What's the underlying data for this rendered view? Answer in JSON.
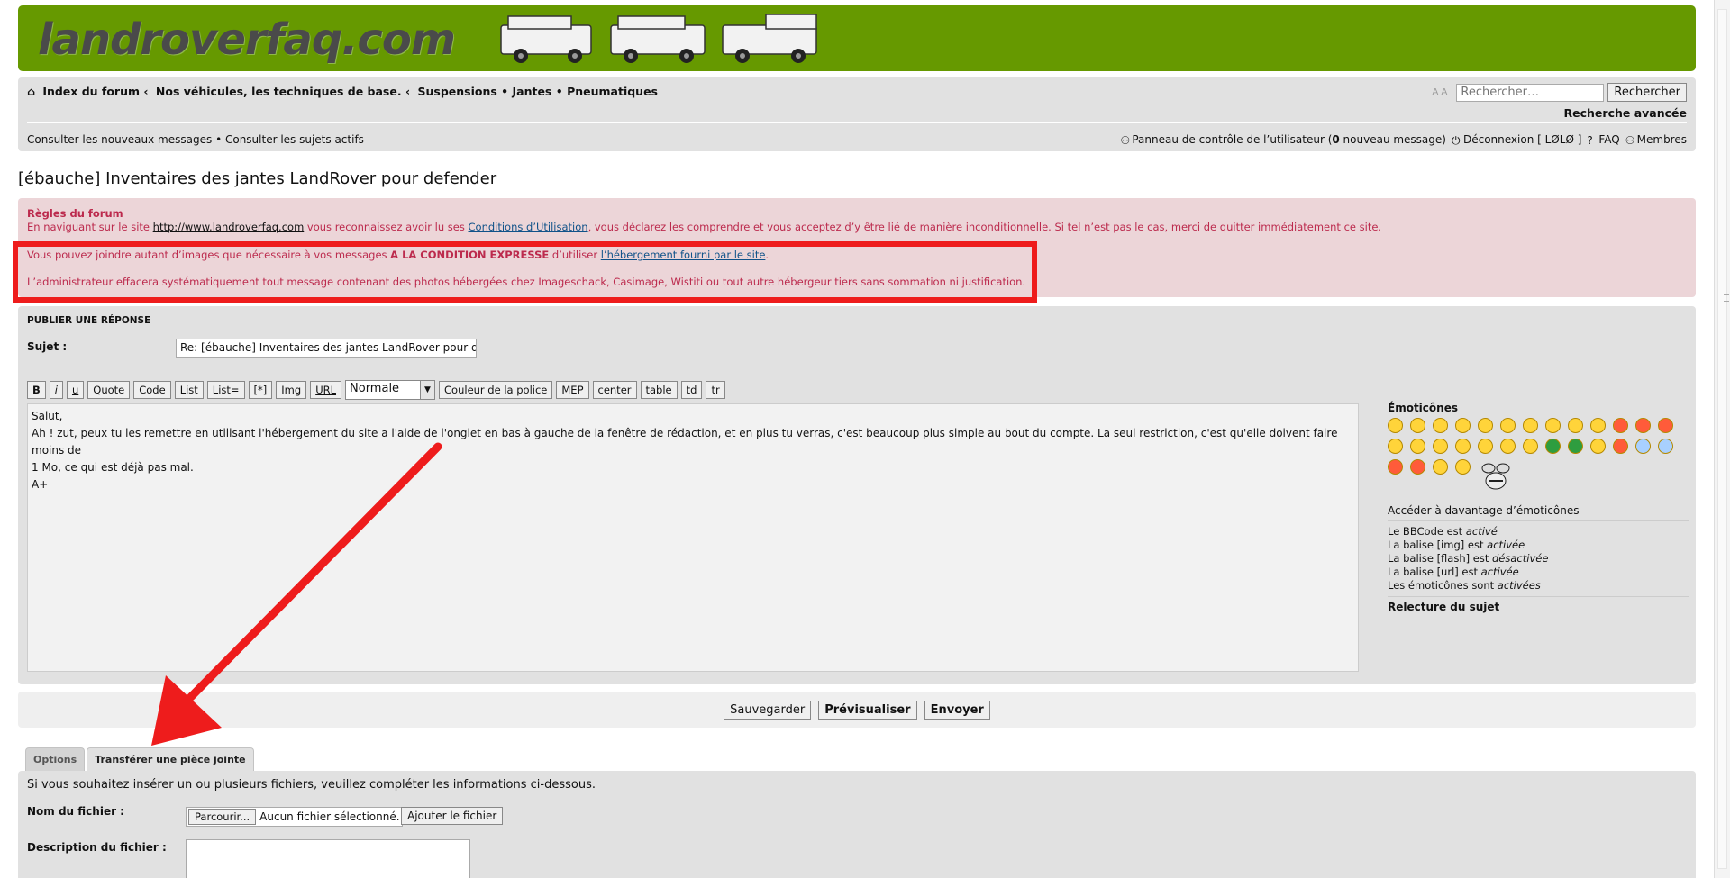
{
  "site": {
    "logo_text": "landroverfaq.com"
  },
  "navbar": {
    "breadcrumb": [
      {
        "label": "Index du forum"
      },
      {
        "label": "Nos véhicules, les techniques de base."
      },
      {
        "label": "Suspensions • Jantes • Pneumatiques"
      }
    ],
    "search_placeholder": "Rechercher…",
    "search_button": "Rechercher",
    "advanced_search": "Recherche avancée",
    "font_controls": "A A",
    "new_messages": "Consulter les nouveaux messages",
    "separator": "•",
    "active_topics": "Consulter les sujets actifs",
    "ucp_pre": "Panneau de contrôle de l’utilisateur (",
    "ucp_count": "0",
    "ucp_post": " nouveau message)",
    "logout": "Déconnexion [ LØLØ ]",
    "faq": "FAQ",
    "members": "Membres"
  },
  "topic": {
    "title": "[ébauche] Inventaires des jantes LandRover pour defender"
  },
  "rules": {
    "title": "Règles du forum",
    "line1_a": "En naviguant sur le site ",
    "line1_site": "http://www.landroverfaq.com",
    "line1_b": " vous reconnaissez avoir lu ses ",
    "line1_link": "Conditions d’Utilisation",
    "line1_c": ", vous déclarez les comprendre et vous acceptez d’y être lié de manière inconditionnelle. Si tel n’est pas le cas, merci de quitter immédiatement ce site.",
    "line2_a": "Vous pouvez joindre autant d’images que nécessaire à vos messages ",
    "line2_bold": "A LA CONDITION EXPRESSE",
    "line2_b": " d’utiliser ",
    "line2_link": "l’hébergement fourni par le site",
    "line2_c": ".",
    "line3": "L’administrateur effacera systématiquement tout message contenant des photos hébergées chez Imageschack, Casimage, Wistiti ou tout autre hébergeur tiers sans sommation ni justification."
  },
  "post": {
    "panel_title": "Publier une réponse",
    "subject_label": "Sujet :",
    "subject_value": "Re: [ébauche] Inventaires des jantes LandRover pour de",
    "toolbar": [
      "B",
      "i",
      "u",
      "Quote",
      "Code",
      "List",
      "List=",
      "[*]",
      "Img",
      "URL"
    ],
    "size_select": "Normale",
    "toolbar2": [
      "Couleur de la police",
      "MEP",
      "center",
      "table",
      "td",
      "tr"
    ],
    "message": "Salut,\nAh ! zut, peux tu les remettre en utilisant l'hébergement du site a l'aide de l'onglet en bas à gauche de la fenêtre de rédaction, et en plus tu verras, c'est beaucoup plus simple au bout du compte. La seul restriction, c'est qu'elle doivent faire moins de\n1 Mo, ce qui est déjà pas mal.\nA+"
  },
  "emoticons": {
    "title": "Émoticônes",
    "more": "Accéder à davantage d’émoticônes",
    "bbcode": {
      "pre": "Le BBCode est ",
      "state": "activé"
    },
    "img": {
      "pre": "La balise [img] est ",
      "state": "activée"
    },
    "flash": {
      "pre": "La balise [flash] est ",
      "state": "désactivée"
    },
    "url": {
      "pre": "La balise [url] est ",
      "state": "activée"
    },
    "smilies": {
      "pre": "Les émoticônes sont ",
      "state": "activées"
    },
    "review": "Relecture du sujet"
  },
  "buttons": {
    "save": "Sauvegarder",
    "preview": "Prévisualiser",
    "submit": "Envoyer"
  },
  "tabs": {
    "options": "Options",
    "attach": "Transférer une pièce jointe"
  },
  "attach": {
    "intro": "Si vous souhaitez insérer un ou plusieurs fichiers, veuillez compléter les informations ci-dessous.",
    "filename_label": "Nom du fichier :",
    "browse": "Parcourir...",
    "no_file": "Aucun fichier sélectionné.",
    "add_file": "Ajouter le fichier",
    "desc_label": "Description du fichier :"
  },
  "colors": {
    "header": "#669900",
    "rules_text": "#bc2a4d",
    "annotation": "#ee1c1c"
  }
}
